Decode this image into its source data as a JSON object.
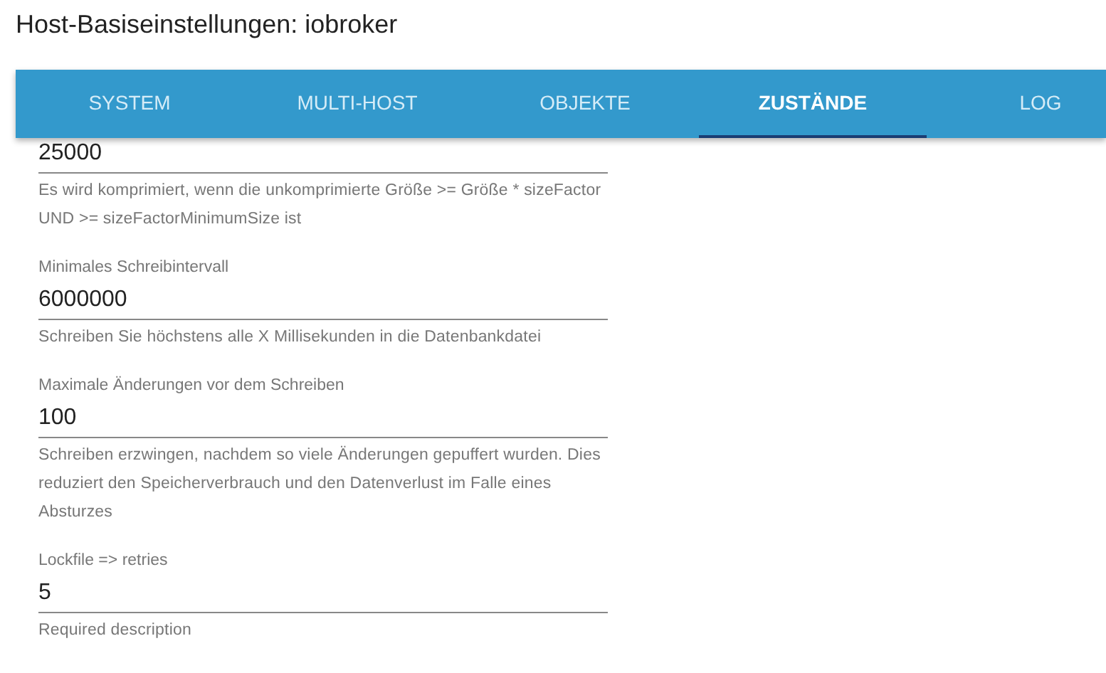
{
  "page": {
    "title": "Host-Basiseinstellungen: iobroker"
  },
  "tabs": [
    {
      "label": "SYSTEM",
      "selected": false
    },
    {
      "label": "MULTI-HOST",
      "selected": false
    },
    {
      "label": "OBJEKTE",
      "selected": false
    },
    {
      "label": "ZUSTÄNDE",
      "selected": true
    },
    {
      "label": "LOG",
      "selected": false
    }
  ],
  "fields": [
    {
      "value": "25000",
      "helper": "Es wird komprimiert, wenn die unkomprimierte Größe >= Größe * sizeFactor UND >= sizeFactorMinimumSize ist"
    },
    {
      "label": "Minimales Schreibintervall",
      "value": "6000000",
      "helper": "Schreiben Sie höchstens alle X Millisekunden in die Datenbankdatei"
    },
    {
      "label": "Maximale Änderungen vor dem Schreiben",
      "value": "100",
      "helper": "Schreiben erzwingen, nachdem so viele Änderungen gepuffert wurden. Dies reduziert den Speicherverbrauch und den Datenverlust im Falle eines Absturzes"
    },
    {
      "label": "Lockfile => retries",
      "value": "5",
      "helper": "Required description"
    }
  ]
}
